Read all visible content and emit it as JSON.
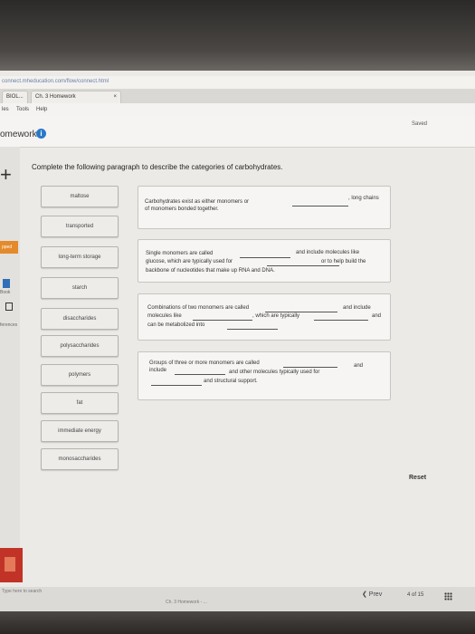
{
  "browser": {
    "url": "connect.mheducation.com/flow/connect.html",
    "tabs": [
      {
        "label": "BIOL..."
      },
      {
        "label": "Ch. 3 Homework"
      }
    ],
    "close_glyph": "×"
  },
  "menu": {
    "items": [
      "les",
      "Tools",
      "Help"
    ]
  },
  "header": {
    "title": "omework",
    "info_icon": "i",
    "status": "Saved"
  },
  "sidebar": {
    "plus": "+",
    "labels": {
      "orange": "pped",
      "book": "Book",
      "references": "ferences"
    }
  },
  "question": {
    "instructions": "Complete the following paragraph to describe the categories of carbohydrates."
  },
  "word_bank": [
    "maltose",
    "transported",
    "long-term storage",
    "starch",
    "disaccharides",
    "polysaccharides",
    "polymers",
    "fat",
    "immediate energy",
    "monosaccharides"
  ],
  "sentences": {
    "s1": {
      "line1a": "Carbohydrates exist as either monomers or",
      "line1b": ", long chains",
      "line2": "of monomers bonded together."
    },
    "s2": {
      "line1a": "Single monomers are called",
      "line1b": "and include molecules like",
      "line2a": "glucose, which are typically used for",
      "line2b": "or to help build the",
      "line3": "backbone of nucleotides that make up RNA and DNA."
    },
    "s3": {
      "line1a": "Combinations of two monomers are called",
      "line1b": "and include",
      "line2a": "molecules like",
      "line2b": ", which are typically",
      "line2c": "and",
      "line3": "can be metabolized into"
    },
    "s4": {
      "line1a": "Groups of three or more monomers are called",
      "line1b": "and",
      "line2a": "include",
      "line2b": "and other molecules typically used for",
      "line3": "and structural support."
    }
  },
  "controls": {
    "reset": "Reset",
    "prev": "❮ Prev",
    "page": "4",
    "of_total": "of 15"
  },
  "taskbar": {
    "search": "Type here to search",
    "app": "Ch. 3 Homework - ..."
  }
}
